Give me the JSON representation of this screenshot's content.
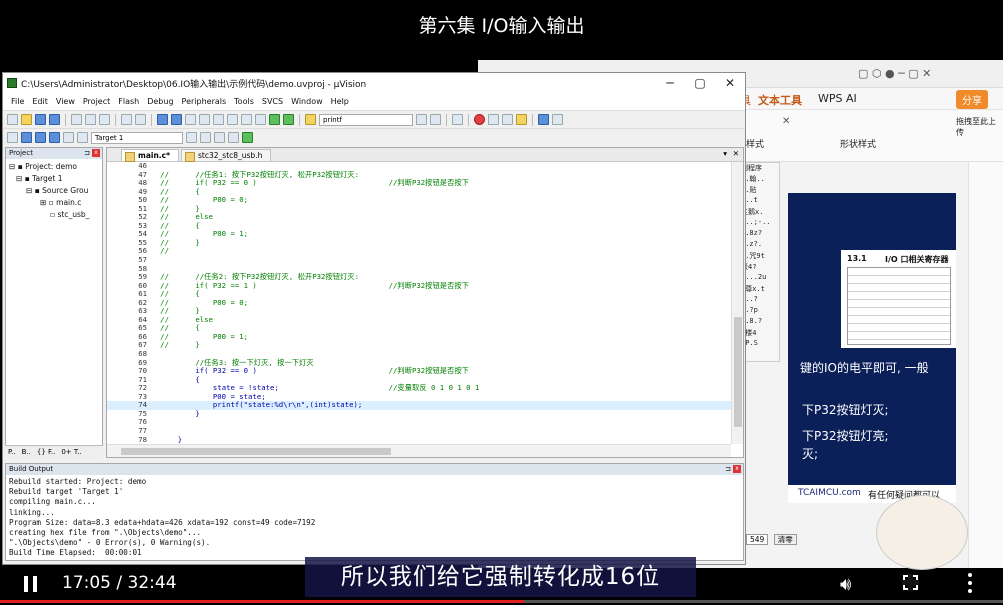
{
  "video": {
    "title": "第六集 I/O输入输出",
    "subtitle": "所以我们给它强制转化成16位",
    "time": "17:05 / 32:44",
    "progress": 0.522
  },
  "uvision": {
    "title": "C:\\Users\\Administrator\\Desktop\\06.IO输入输出\\示例代码\\demo.uvproj - µVision",
    "menu": [
      "File",
      "Edit",
      "View",
      "Project",
      "Flash",
      "Debug",
      "Peripherals",
      "Tools",
      "SVCS",
      "Window",
      "Help"
    ],
    "find_text": "printf",
    "target": "Target 1",
    "project_panel_title": "Project",
    "tree": [
      "Project: demo",
      "Target 1",
      "Source Grou",
      "main.c",
      "stc_usb_"
    ],
    "project_tabs": [
      "P..",
      "B..",
      "{} F..",
      "0+ T.."
    ],
    "editor_tabs": [
      "main.c*",
      "stc32_stc8_usb.h"
    ],
    "build_output_title": "Build Output",
    "code_lines": [
      {
        "n": "46",
        "t": ""
      },
      {
        "n": "47",
        "t": "//      //任务1: 按下P32按钮灯灭, 松开P32按钮灯灭:"
      },
      {
        "n": "48",
        "t": "//      if( P32 == 0 )                              //判断P32按钮是否按下"
      },
      {
        "n": "49",
        "t": "//      {"
      },
      {
        "n": "50",
        "t": "//          P00 = 0;"
      },
      {
        "n": "51",
        "t": "//      }"
      },
      {
        "n": "52",
        "t": "//      else"
      },
      {
        "n": "53",
        "t": "//      {"
      },
      {
        "n": "54",
        "t": "//          P00 = 1;"
      },
      {
        "n": "55",
        "t": "//      }"
      },
      {
        "n": "56",
        "t": "//"
      },
      {
        "n": "57",
        "t": ""
      },
      {
        "n": "58",
        "t": ""
      },
      {
        "n": "59",
        "t": "//      //任务2: 按下P32按钮灯灭, 松开P32按钮灯灭:"
      },
      {
        "n": "60",
        "t": "//      if( P32 == 1 )                              //判断P32按钮是否按下"
      },
      {
        "n": "61",
        "t": "//      {"
      },
      {
        "n": "62",
        "t": "//          P00 = 0;"
      },
      {
        "n": "63",
        "t": "//      }"
      },
      {
        "n": "64",
        "t": "//      else"
      },
      {
        "n": "65",
        "t": "//      {"
      },
      {
        "n": "66",
        "t": "//          P00 = 1;"
      },
      {
        "n": "67",
        "t": "//      }"
      },
      {
        "n": "68",
        "t": ""
      },
      {
        "n": "69",
        "t": "        //任务3: 按一下灯灭, 按一下灯灭"
      },
      {
        "n": "70",
        "t": "        if( P32 == 0 )                              //判断P32按钮是否按下"
      },
      {
        "n": "71",
        "t": "        {"
      },
      {
        "n": "72",
        "t": "            state = !state;                         //变量取反 0 1 0 1 0 1"
      },
      {
        "n": "73",
        "t": "            P00 = state;"
      },
      {
        "n": "74",
        "t": "            printf(\"state:%d\\r\\n\",(int)state);"
      },
      {
        "n": "75",
        "t": "        }"
      },
      {
        "n": "76",
        "t": ""
      },
      {
        "n": "77",
        "t": ""
      },
      {
        "n": "78",
        "t": "    }"
      },
      {
        "n": "79",
        "t": ""
      }
    ],
    "build_lines": [
      "Rebuild started: Project: demo",
      "Rebuild target 'Target 1'",
      "compiling main.c...",
      "linking...",
      "Program Size: data=8.3 edata+hdata=426 xdata=192 const=49 code=7192",
      "creating hex file from \".\\Objects\\demo\"...",
      "\".\\Objects\\demo\" - 0 Error(s), 0 Warning(s).",
      "Build Time Elapsed:  00:00:01"
    ]
  },
  "background_app": {
    "menu_items": [
      "具",
      "文本工具",
      "WPS AI"
    ],
    "share_label": "分享",
    "drag_label": "拖拽至此上传",
    "ribbon_items": [
      "样式",
      "形状样式"
    ],
    "side_label": "例程序",
    "doc_heading": "13.1",
    "doc_title": "I/O 口相关寄存器",
    "doc_text_1": "键的IO的电平即可, 一般",
    "doc_text_2": "下P32按钮灯灭;",
    "doc_text_3": "下P32按钮灯亮;",
    "doc_text_4": "灭;",
    "doc_footer_1": "TCAIMCU.com",
    "doc_footer_2": "有任何疑问都可以",
    "count_value": "549",
    "clear_label": "清零",
    "left_snippets": [
      "..翰..",
      "..贴",
      "...t",
      "主鹅x.",
      "...;-..",
      "D.8z?",
      "0.z?.",
      "-.咒9t",
      "簌4?",
      "....2u",
      "y尊x.t",
      "s..?",
      "..?p",
      "D.8.?",
      "C楼4",
      "[P.S"
    ]
  }
}
